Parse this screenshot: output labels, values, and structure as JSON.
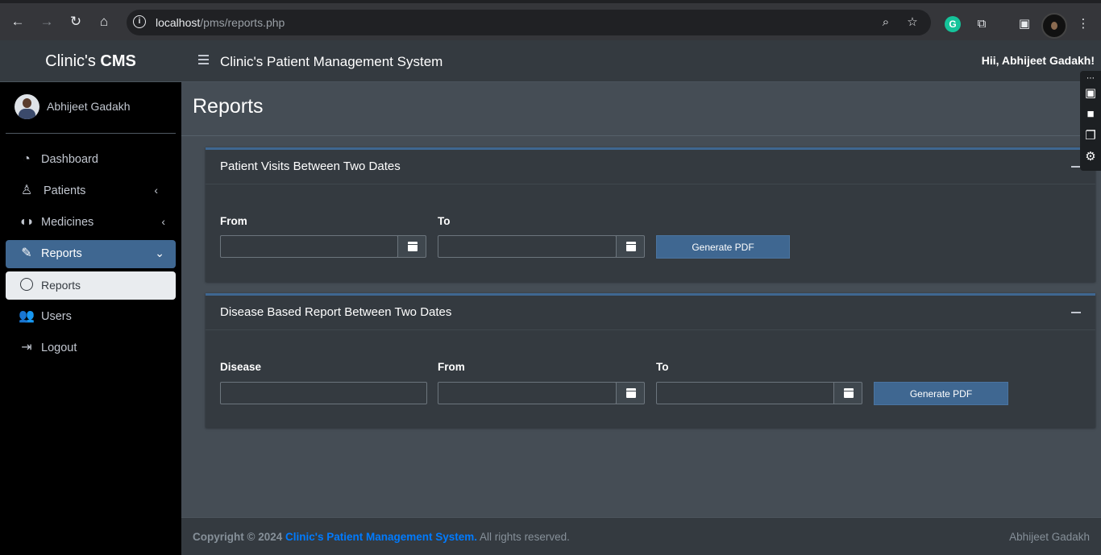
{
  "browser": {
    "url_host": "localhost",
    "url_path": "/pms/reports.php"
  },
  "brand": {
    "prefix": "Clinic's",
    "bold": "CMS"
  },
  "user": {
    "name": "Abhijeet Gadakh"
  },
  "topbar": {
    "title": "Clinic's Patient Management System",
    "greeting": "Hii, Abhijeet Gadakh!"
  },
  "sidebar": {
    "items": [
      {
        "label": "Dashboard",
        "icon": "tachometer-icon"
      },
      {
        "label": "Patients",
        "icon": "user-injured-icon"
      },
      {
        "label": "Medicines",
        "icon": "pills-icon"
      },
      {
        "label": "Reports",
        "icon": "edit-icon"
      },
      {
        "label": "Reports",
        "icon": "circle-icon"
      },
      {
        "label": "Users",
        "icon": "users-icon"
      },
      {
        "label": "Logout",
        "icon": "sign-out-icon"
      }
    ]
  },
  "page": {
    "title": "Reports"
  },
  "card1": {
    "title": "Patient Visits Between Two Dates",
    "from_label": "From",
    "to_label": "To",
    "button": "Generate PDF",
    "from_value": "",
    "to_value": ""
  },
  "card2": {
    "title": "Disease Based Report Between Two Dates",
    "disease_label": "Disease",
    "from_label": "From",
    "to_label": "To",
    "button": "Generate PDF",
    "disease_value": "",
    "from_value": "",
    "to_value": ""
  },
  "footer": {
    "copyright": "Copyright © 2024",
    "link": "Clinic's Patient Management System.",
    "rights": "All rights reserved.",
    "author": "Abhijeet Gadakh"
  },
  "colors": {
    "accent": "#3f6791",
    "link": "#007bff",
    "sidebar_bg": "#000000",
    "content_bg": "#454d55"
  }
}
